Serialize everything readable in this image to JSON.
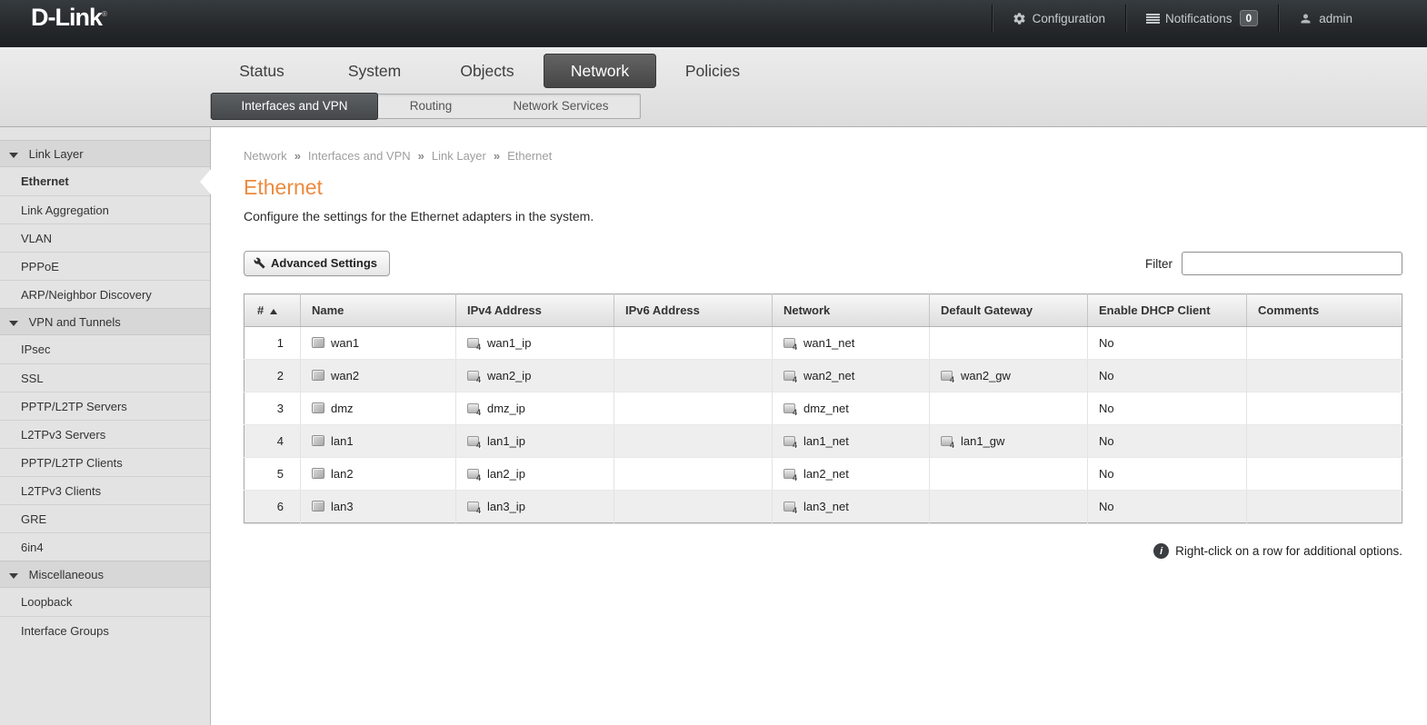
{
  "topbar": {
    "logo": "D-Link",
    "registered_mark": "®",
    "configuration_label": "Configuration",
    "notifications_label": "Notifications",
    "notifications_count": "0",
    "username": "admin"
  },
  "nav": {
    "tabs": [
      {
        "label": "Status"
      },
      {
        "label": "System"
      },
      {
        "label": "Objects"
      },
      {
        "label": "Network",
        "active": true
      },
      {
        "label": "Policies"
      }
    ],
    "subtabs": [
      {
        "label": "Interfaces and VPN",
        "active": true
      },
      {
        "label": "Routing"
      },
      {
        "label": "Network Services"
      }
    ]
  },
  "sidebar": {
    "entries": [
      {
        "type": "header",
        "label": "Link Layer"
      },
      {
        "type": "item",
        "label": "Ethernet",
        "active": true
      },
      {
        "type": "item",
        "label": "Link Aggregation"
      },
      {
        "type": "item",
        "label": "VLAN"
      },
      {
        "type": "item",
        "label": "PPPoE"
      },
      {
        "type": "item",
        "label": "ARP/Neighbor Discovery"
      },
      {
        "type": "header",
        "label": "VPN and Tunnels"
      },
      {
        "type": "item",
        "label": "IPsec"
      },
      {
        "type": "item",
        "label": "SSL"
      },
      {
        "type": "item",
        "label": "PPTP/L2TP Servers"
      },
      {
        "type": "item",
        "label": "L2TPv3 Servers"
      },
      {
        "type": "item",
        "label": "PPTP/L2TP Clients"
      },
      {
        "type": "item",
        "label": "L2TPv3 Clients"
      },
      {
        "type": "item",
        "label": "GRE"
      },
      {
        "type": "item",
        "label": "6in4"
      },
      {
        "type": "header",
        "label": "Miscellaneous"
      },
      {
        "type": "item",
        "label": "Loopback"
      },
      {
        "type": "item",
        "label": "Interface Groups"
      }
    ]
  },
  "breadcrumb": {
    "items": [
      {
        "label": "Network"
      },
      {
        "label": "Interfaces and VPN"
      },
      {
        "label": "Link Layer"
      },
      {
        "label": "Ethernet"
      }
    ]
  },
  "page": {
    "title": "Ethernet",
    "description": "Configure the settings for the Ethernet adapters in the system."
  },
  "toolbar": {
    "advanced_settings_label": "Advanced Settings",
    "filter_label": "Filter",
    "filter_value": ""
  },
  "table": {
    "columns": [
      {
        "label": "#",
        "sorted": true
      },
      {
        "label": "Name"
      },
      {
        "label": "IPv4 Address"
      },
      {
        "label": "IPv6 Address"
      },
      {
        "label": "Network"
      },
      {
        "label": "Default Gateway"
      },
      {
        "label": "Enable DHCP Client"
      },
      {
        "label": "Comments"
      }
    ],
    "rows": [
      {
        "num": "1",
        "name": "wan1",
        "ipv4": "wan1_ip",
        "ipv6": "",
        "network": "wan1_net",
        "gateway": "",
        "dhcp": "No",
        "comments": ""
      },
      {
        "num": "2",
        "name": "wan2",
        "ipv4": "wan2_ip",
        "ipv6": "",
        "network": "wan2_net",
        "gateway": "wan2_gw",
        "dhcp": "No",
        "comments": ""
      },
      {
        "num": "3",
        "name": "dmz",
        "ipv4": "dmz_ip",
        "ipv6": "",
        "network": "dmz_net",
        "gateway": "",
        "dhcp": "No",
        "comments": ""
      },
      {
        "num": "4",
        "name": "lan1",
        "ipv4": "lan1_ip",
        "ipv6": "",
        "network": "lan1_net",
        "gateway": "lan1_gw",
        "dhcp": "No",
        "comments": ""
      },
      {
        "num": "5",
        "name": "lan2",
        "ipv4": "lan2_ip",
        "ipv6": "",
        "network": "lan2_net",
        "gateway": "",
        "dhcp": "No",
        "comments": ""
      },
      {
        "num": "6",
        "name": "lan3",
        "ipv4": "lan3_ip",
        "ipv6": "",
        "network": "lan3_net",
        "gateway": "",
        "dhcp": "No",
        "comments": ""
      }
    ]
  },
  "footer": {
    "note": "Right-click on a row for additional options."
  },
  "colors": {
    "accent_orange": "#ee8a3e",
    "active_tab": "#4a4a4a",
    "topbar_background": "#26292c"
  }
}
